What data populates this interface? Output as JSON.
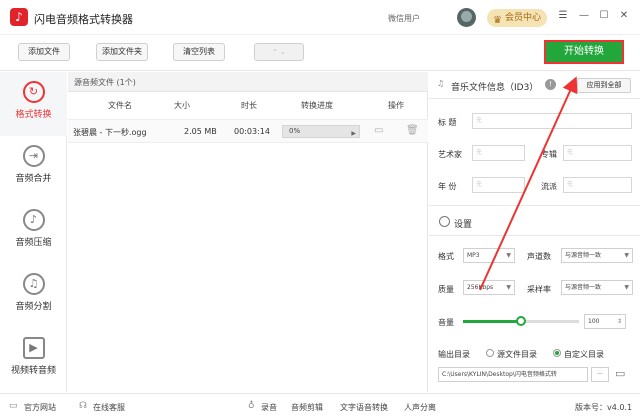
{
  "window": {
    "title": "闪电音频格式转换器",
    "user_label": "微信用户",
    "vip_label": "会员中心",
    "minimize": "—",
    "menu": "☰",
    "maximize": "☐",
    "close": "✕"
  },
  "toolbar": {
    "add_file": "添加文件",
    "add_folder": "添加文件夹",
    "clear_list": "清空列表",
    "dropdown": "⌃  ⌄",
    "start": "开始转换"
  },
  "sidebar": {
    "items": [
      {
        "label": "格式转换",
        "icon": "↻"
      },
      {
        "label": "音频合并",
        "icon": "⇥"
      },
      {
        "label": "音频压缩",
        "icon": "♪"
      },
      {
        "label": "音频分割",
        "icon": "♫"
      },
      {
        "label": "视频转音频",
        "icon": "▶"
      }
    ]
  },
  "file_panel": {
    "header": "源音频文件 (1个)",
    "columns": [
      "文件名",
      "大小",
      "时长",
      "转换进度",
      "操作"
    ],
    "rows": [
      {
        "name": "张碧晨 - 下一秒.ogg",
        "size": "2.05 MB",
        "duration": "00:03:14",
        "progress": "0%"
      }
    ]
  },
  "id3": {
    "title": "音乐文件信息（ID3）",
    "apply_all": "应用到全部",
    "fields": {
      "title_label": "标    题",
      "artist_label": "艺术家",
      "album_label": "专辑",
      "year_label": "年    份",
      "genre_label": "流派",
      "placeholder": "无"
    }
  },
  "settings": {
    "title": "设置",
    "format_label": "格式",
    "format_value": "MP3",
    "channel_label": "声道数",
    "channel_value": "与源音频一致",
    "quality_label": "质量",
    "quality_value": "256Kbps",
    "samplerate_label": "采样率",
    "samplerate_value": "与源音频一致",
    "volume_label": "音量",
    "volume_value": "100",
    "volume_level": 0.5,
    "output_label": "输出目录",
    "source_dir": "源文件目录",
    "custom_dir": "自定义目录",
    "path": "C:\\Users\\KYLIN\\Desktop\\闪电音频格式转",
    "more": "···"
  },
  "status": {
    "website": "官方网站",
    "support": "在线客服",
    "record": "录音",
    "edit": "音频剪辑",
    "tts": "文字语音转换",
    "vocal": "人声分离",
    "version": "版本号：v4.0.1"
  },
  "colors": {
    "accent": "#23a63c",
    "highlight": "#e33333"
  }
}
